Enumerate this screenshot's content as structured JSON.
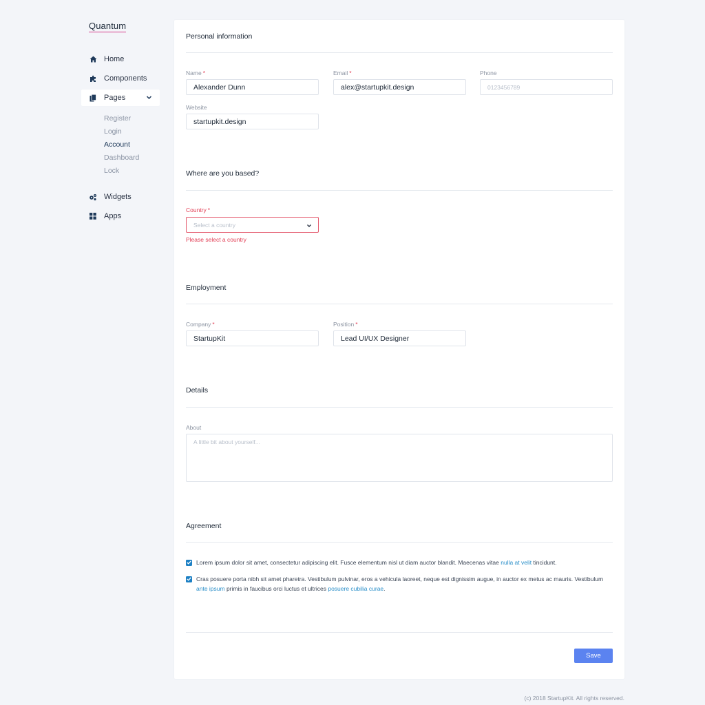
{
  "brand": "Quantum",
  "nav": {
    "home": "Home",
    "components": "Components",
    "pages": "Pages",
    "sub_pages": [
      "Register",
      "Login",
      "Account",
      "Dashboard",
      "Lock"
    ],
    "widgets": "Widgets",
    "apps": "Apps"
  },
  "personal": {
    "title": "Personal information",
    "name_label": "Name",
    "name_value": "Alexander Dunn",
    "email_label": "Email",
    "email_value": "alex@startupkit.design",
    "phone_label": "Phone",
    "phone_placeholder": "0123456789",
    "website_label": "Website",
    "website_value": "startupkit.design"
  },
  "location": {
    "title": "Where are you based?",
    "country_label": "Country",
    "country_placeholder": "Select a country",
    "country_error": "Please select a country"
  },
  "employment": {
    "title": "Employment",
    "company_label": "Company",
    "company_value": "StartupKit",
    "position_label": "Position",
    "position_value": "Lead UI/UX Designer"
  },
  "details": {
    "title": "Details",
    "about_label": "About",
    "about_placeholder": "A little bit about yourself..."
  },
  "agreement": {
    "title": "Agreement",
    "item1_text_a": "Lorem ipsum dolor sit amet, consectetur adipiscing elit. Fusce elementum nisl ut diam auctor blandit. Maecenas vitae ",
    "item1_link": "nulla at velit",
    "item1_text_b": " tincidunt.",
    "item2_text_a": "Cras posuere porta nibh sit amet pharetra. Vestibulum pulvinar, eros a vehicula laoreet, neque est dignissim augue, in auctor ex metus ac mauris. Vestibulum ",
    "item2_link1": "ante ipsum",
    "item2_text_b": " primis in faucibus orci luctus et ultrices ",
    "item2_link2": "posuere cubilia curae",
    "item2_text_c": "."
  },
  "required_mark": "*",
  "save_label": "Save",
  "footer": "(c) 2018 StartupKit. All rights reserved.",
  "colors": {
    "accent": "#5b83f0",
    "error": "#e23b52",
    "link": "#2a8fc9",
    "checkbox": "#1d80c4",
    "logo_underline": "#d63b8a"
  }
}
